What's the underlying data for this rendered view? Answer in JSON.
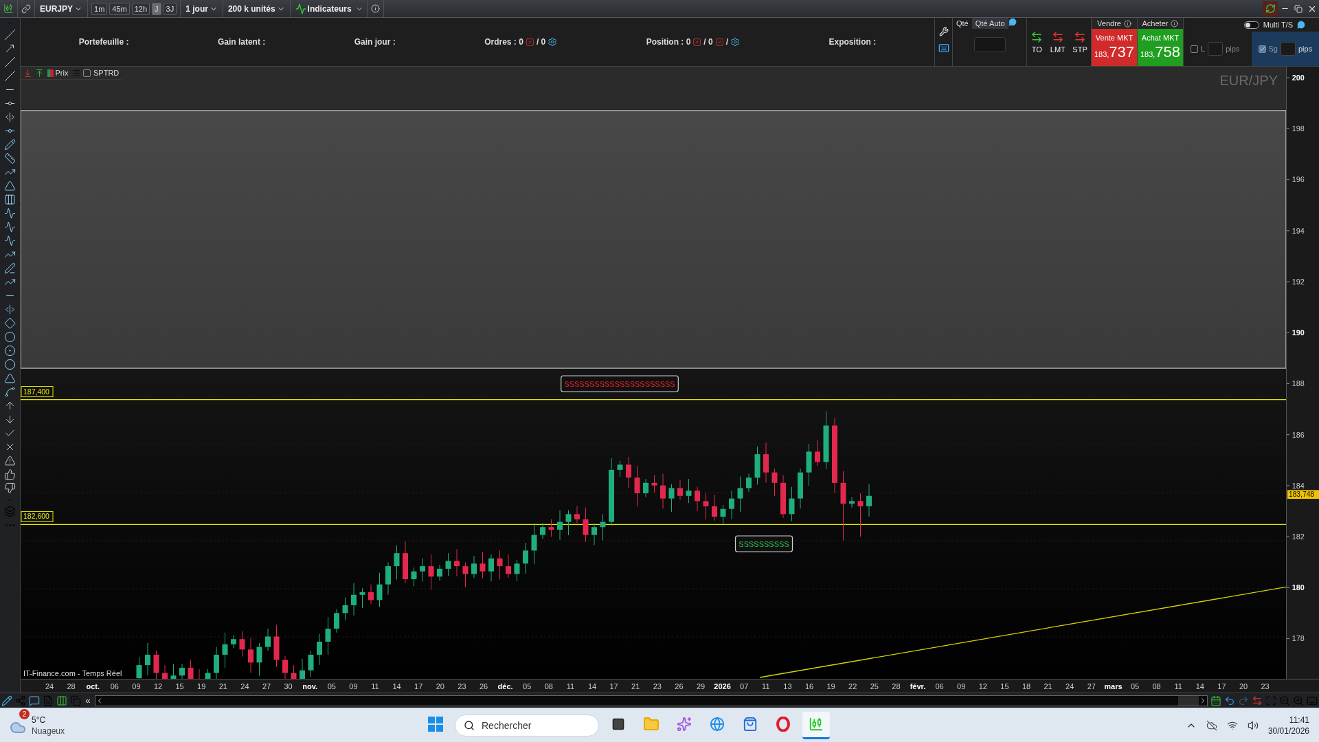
{
  "toolbar": {
    "symbol": "EURJPY",
    "timeframes": [
      {
        "label": "1m",
        "selected": false
      },
      {
        "label": "45m",
        "selected": false
      },
      {
        "label": "12h",
        "selected": false
      },
      {
        "label": "J",
        "selected": true
      },
      {
        "label": "3J",
        "selected": false
      }
    ],
    "period": "1 jour",
    "size": "200 k unités",
    "indicators": "Indicateurs"
  },
  "account": [
    {
      "kind": "plain",
      "label": "Portefeuille :"
    },
    {
      "kind": "plain",
      "label": "Gain latent :"
    },
    {
      "kind": "plain",
      "label": "Gain jour :"
    },
    {
      "kind": "orders",
      "label": "Ordres : 0",
      "parts": [
        "/ 0"
      ]
    },
    {
      "kind": "position",
      "label": "Position : 0",
      "parts": [
        "/ 0",
        "/"
      ]
    },
    {
      "kind": "plain",
      "label": "Exposition :"
    }
  ],
  "order_panel": {
    "qty_tabs": [
      {
        "label": "Qté",
        "selected": false
      },
      {
        "label": "Qté Auto",
        "selected": true
      }
    ],
    "order_types": [
      "TO",
      "LMT",
      "STP"
    ],
    "sell": {
      "header": "Vendre",
      "button": "Vente MKT",
      "price_prefix": "183,",
      "price_main": "737"
    },
    "buy": {
      "header": "Acheter",
      "button": "Achat MKT",
      "price_prefix": "183,",
      "price_main": "758"
    },
    "multi_ts": {
      "label": "Multi T/S",
      "on": false
    },
    "stops": [
      {
        "label": "L",
        "checked": false,
        "unit": "pips"
      },
      {
        "label": "Sg",
        "checked": true,
        "unit": "pips"
      }
    ]
  },
  "chart": {
    "price_label": "Prix",
    "study": {
      "label": "SPTRD",
      "checked": false
    },
    "watermark": "EUR/JPY",
    "price_axis": [
      {
        "text": "200",
        "bold": true
      },
      {
        "text": "198",
        "bold": false
      },
      {
        "text": "196",
        "bold": false
      },
      {
        "text": "194",
        "bold": false
      },
      {
        "text": "192",
        "bold": false
      },
      {
        "text": "190",
        "bold": true
      },
      {
        "text": "188",
        "bold": false
      },
      {
        "text": "186",
        "bold": false
      },
      {
        "text": "184",
        "bold": false
      },
      {
        "text": "182",
        "bold": false
      },
      {
        "text": "180",
        "bold": true
      },
      {
        "text": "178",
        "bold": false
      }
    ],
    "current_price": "183,748",
    "levels": [
      {
        "label": "187,400"
      },
      {
        "label": "182,600"
      }
    ],
    "labels": [
      {
        "text": "SSSSSSSSSSSSSSSSSSSSSS",
        "color": "#e8202a"
      },
      {
        "text": "SSSSSSSSSS",
        "color": "#31b94a"
      }
    ],
    "source": "IT-Finance.com - Temps Réel",
    "date_axis": [
      {
        "text": "24",
        "bold": false
      },
      {
        "text": "28",
        "bold": false
      },
      {
        "text": "oct.",
        "bold": true
      },
      {
        "text": "06",
        "bold": false
      },
      {
        "text": "09",
        "bold": false
      },
      {
        "text": "12",
        "bold": false
      },
      {
        "text": "15",
        "bold": false
      },
      {
        "text": "19",
        "bold": false
      },
      {
        "text": "21",
        "bold": false
      },
      {
        "text": "24",
        "bold": false
      },
      {
        "text": "27",
        "bold": false
      },
      {
        "text": "30",
        "bold": false
      },
      {
        "text": "nov.",
        "bold": true
      },
      {
        "text": "05",
        "bold": false
      },
      {
        "text": "09",
        "bold": false
      },
      {
        "text": "11",
        "bold": false
      },
      {
        "text": "14",
        "bold": false
      },
      {
        "text": "17",
        "bold": false
      },
      {
        "text": "20",
        "bold": false
      },
      {
        "text": "23",
        "bold": false
      },
      {
        "text": "26",
        "bold": false
      },
      {
        "text": "déc.",
        "bold": true
      },
      {
        "text": "05",
        "bold": false
      },
      {
        "text": "08",
        "bold": false
      },
      {
        "text": "11",
        "bold": false
      },
      {
        "text": "14",
        "bold": false
      },
      {
        "text": "17",
        "bold": false
      },
      {
        "text": "21",
        "bold": false
      },
      {
        "text": "23",
        "bold": false
      },
      {
        "text": "26",
        "bold": false
      },
      {
        "text": "29",
        "bold": false
      },
      {
        "text": "2026",
        "bold": true
      },
      {
        "text": "07",
        "bold": false
      },
      {
        "text": "11",
        "bold": false
      },
      {
        "text": "13",
        "bold": false
      },
      {
        "text": "16",
        "bold": false
      },
      {
        "text": "19",
        "bold": false
      },
      {
        "text": "22",
        "bold": false
      },
      {
        "text": "25",
        "bold": false
      },
      {
        "text": "28",
        "bold": false
      },
      {
        "text": "févr.",
        "bold": true
      },
      {
        "text": "06",
        "bold": false
      },
      {
        "text": "09",
        "bold": false
      },
      {
        "text": "12",
        "bold": false
      },
      {
        "text": "15",
        "bold": false
      },
      {
        "text": "18",
        "bold": false
      },
      {
        "text": "21",
        "bold": false
      },
      {
        "text": "24",
        "bold": false
      },
      {
        "text": "27",
        "bold": false
      },
      {
        "text": "mars",
        "bold": true
      },
      {
        "text": "05",
        "bold": false
      },
      {
        "text": "08",
        "bold": false
      },
      {
        "text": "11",
        "bold": false
      },
      {
        "text": "14",
        "bold": false
      },
      {
        "text": "17",
        "bold": false
      },
      {
        "text": "20",
        "bold": false
      },
      {
        "text": "23",
        "bold": false
      }
    ]
  },
  "bottom_toolbar": {
    "collapse": "«"
  },
  "taskbar": {
    "weather": {
      "badge": "2",
      "temp": "5°C",
      "desc": "Nuageux"
    },
    "search": {
      "placeholder": "Rechercher"
    },
    "apps": [
      {
        "kind": "taskview",
        "selected": false
      },
      {
        "kind": "folder",
        "selected": false
      },
      {
        "kind": "copilot",
        "selected": false
      },
      {
        "kind": "browser",
        "selected": false
      },
      {
        "kind": "store",
        "selected": false
      },
      {
        "kind": "opera",
        "selected": false
      },
      {
        "kind": "trading",
        "selected": true
      }
    ],
    "time": "11:41",
    "date": "30/01/2026"
  }
}
